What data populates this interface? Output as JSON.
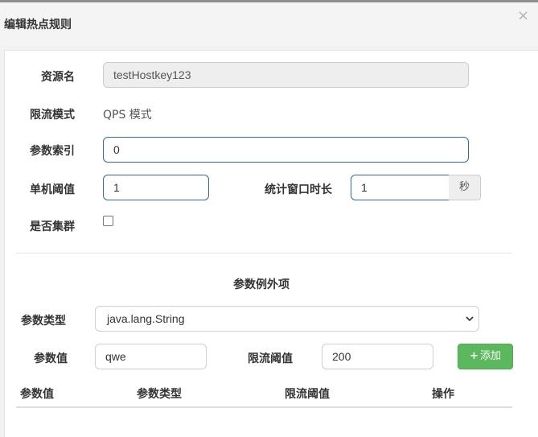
{
  "dialog": {
    "title": "编辑热点规则",
    "close": "×"
  },
  "form": {
    "resource_label": "资源名",
    "resource_value": "testHostkey123",
    "mode_label": "限流模式",
    "mode_value": "QPS 模式",
    "param_index_label": "参数索引",
    "param_index_value": "0",
    "threshold_label": "单机阈值",
    "threshold_value": "1",
    "window_label": "统计窗口时长",
    "window_value": "1",
    "window_unit": "秒",
    "cluster_label": "是否集群",
    "cluster_checked": false
  },
  "exceptions": {
    "section_title": "参数例外项",
    "type_label": "参数类型",
    "type_selected": "java.lang.String",
    "value_label": "参数值",
    "value_value": "qwe",
    "limit_label": "限流阈值",
    "limit_value": "200",
    "add_button": "添加",
    "table_headers": [
      "参数值",
      "参数类型",
      "限流阈值",
      "操作"
    ]
  }
}
